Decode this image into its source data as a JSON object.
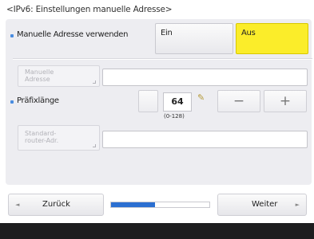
{
  "title": "<IPv6: Einstellungen manuelle Adresse>",
  "manual_address": {
    "label": "Manuelle Adresse verwenden",
    "on_label": "Ein",
    "off_label": "Aus",
    "selected": "Aus"
  },
  "manual_address_field": {
    "button_label": "Manuelle Adresse",
    "value": ""
  },
  "prefix_length": {
    "label": "Präfixlänge",
    "value": "64",
    "range": "(0-128)",
    "minus": "−",
    "plus": "+",
    "clear_icon": "clear-icon"
  },
  "default_router": {
    "button_label": "Standard-router-Adr.",
    "value": ""
  },
  "footer": {
    "back_label": "Zurück",
    "next_label": "Weiter",
    "progress": 0.45,
    "back_arrow": "◄",
    "next_arrow": "►"
  },
  "colors": {
    "accent": "#4a8de0",
    "selected": "#fbed2a",
    "progress": "#2b6fd1"
  }
}
